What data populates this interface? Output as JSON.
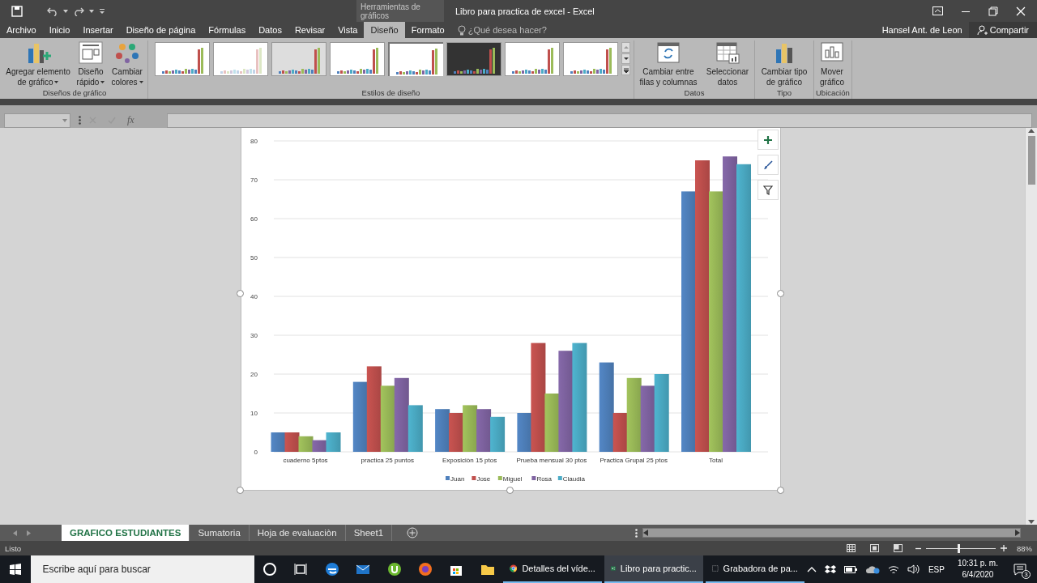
{
  "title_bar": {
    "context_label": "Herramientas de gráficos",
    "title": "Libro para practica de excel - Excel"
  },
  "menu_tabs": [
    {
      "label": "Archivo",
      "selected": false
    },
    {
      "label": "Inicio",
      "selected": false
    },
    {
      "label": "Insertar",
      "selected": false
    },
    {
      "label": "Diseño de página",
      "selected": false
    },
    {
      "label": "Fórmulas",
      "selected": false
    },
    {
      "label": "Datos",
      "selected": false
    },
    {
      "label": "Revisar",
      "selected": false
    },
    {
      "label": "Vista",
      "selected": false
    },
    {
      "label": "Diseño",
      "selected": true
    },
    {
      "label": "Formato",
      "selected": false
    }
  ],
  "search": {
    "placeholder": "¿Qué desea hacer?"
  },
  "user": "Hansel Ant. de Leon",
  "share": "Compartir",
  "ribbon": {
    "groups": [
      {
        "label": "Diseños de gráfico",
        "buttons": [
          {
            "label": "Agregar elemento de gráfico",
            "dropdown": true
          },
          {
            "label": "Diseño rápido",
            "dropdown": true
          },
          {
            "label": "Cambiar colores",
            "dropdown": true
          }
        ]
      },
      {
        "label": "Estilos de diseño",
        "styles": [
          {
            "kind": "light",
            "selected": false
          },
          {
            "kind": "outline",
            "selected": false
          },
          {
            "kind": "gradient",
            "selected": false
          },
          {
            "kind": "light",
            "selected": false
          },
          {
            "kind": "light",
            "selected": true
          },
          {
            "kind": "dark",
            "selected": false
          },
          {
            "kind": "light",
            "selected": false
          },
          {
            "kind": "light",
            "selected": false
          }
        ]
      },
      {
        "label": "Datos",
        "buttons": [
          {
            "label": "Cambiar entre filas y columnas",
            "dropdown": false
          },
          {
            "label": "Seleccionar datos",
            "dropdown": false
          }
        ]
      },
      {
        "label": "Tipo",
        "buttons": [
          {
            "label": "Cambiar tipo de gráfico",
            "dropdown": false
          }
        ]
      },
      {
        "label": "Ubicación",
        "buttons": [
          {
            "label": "Mover gráfico",
            "dropdown": false
          }
        ]
      }
    ]
  },
  "formula_bar": {
    "function_label": "fx",
    "disabled": true
  },
  "chart_data": {
    "type": "bar",
    "categories": [
      "cuaderno 5ptos",
      "practica 25 puntos",
      "Exposiciòn 15 ptos",
      "Prueba mensual 30 ptos",
      "Practica Grupal 25 ptos",
      "Total"
    ],
    "ylim": [
      0,
      80
    ],
    "grid": true,
    "legend": "bottom",
    "yticks": [
      0,
      10,
      20,
      30,
      40,
      50,
      60,
      70,
      80
    ],
    "series": [
      {
        "name": "Juan",
        "color": "#4f81bd",
        "values": [
          5,
          18,
          11,
          10,
          23,
          67
        ]
      },
      {
        "name": "Jose",
        "color": "#c0504d",
        "values": [
          5,
          22,
          10,
          28,
          10,
          75
        ]
      },
      {
        "name": "Miguel",
        "color": "#9bbb59",
        "values": [
          4,
          17,
          12,
          15,
          19,
          67
        ]
      },
      {
        "name": "Rosa",
        "color": "#8064a2",
        "values": [
          3,
          19,
          11,
          26,
          17,
          76
        ]
      },
      {
        "name": "Claudia",
        "color": "#4bacc6",
        "values": [
          5,
          12,
          9,
          28,
          20,
          74
        ]
      }
    ]
  },
  "sheet_tabs": [
    {
      "label": "GRAFICO ESTUDIANTES",
      "selected": true
    },
    {
      "label": "Sumatoria",
      "selected": false
    },
    {
      "label": "Hoja de evaluaciòn",
      "selected": false
    },
    {
      "label": "Sheet1",
      "selected": false
    }
  ],
  "status_bar": {
    "status": "Listo",
    "zoom": "88%",
    "zoom_slider": {
      "level": 0.45
    }
  },
  "taskbar": {
    "search": {
      "placeholder": "Escribe aquí para buscar"
    },
    "windows": [
      {
        "label": "Detalles del víde...",
        "active": false
      },
      {
        "label": "Libro para practic...",
        "active": true
      },
      {
        "label": "Grabadora de pa...",
        "active": false
      }
    ],
    "language": "ESP",
    "time": "10:31 p. m.",
    "date": "6/4/2020",
    "notifications": "3"
  }
}
